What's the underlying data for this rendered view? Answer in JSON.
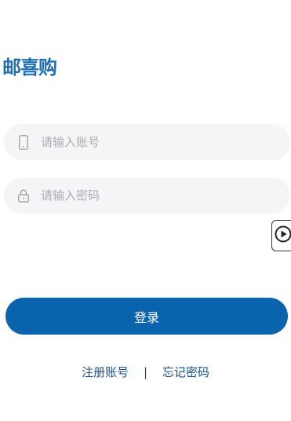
{
  "brand": {
    "logo_text": "邮喜购",
    "color": "#1f6fb3"
  },
  "form": {
    "account": {
      "placeholder": "请输入账号",
      "value": "",
      "icon": "phone-icon"
    },
    "password": {
      "placeholder": "请输入密码",
      "value": "",
      "icon": "lock-icon"
    }
  },
  "floating": {
    "icon": "play-icon"
  },
  "actions": {
    "login_label": "登录",
    "login_color": "#0a63ad",
    "register_label": "注册账号",
    "separator": "|",
    "forgot_label": "忘记密码"
  }
}
